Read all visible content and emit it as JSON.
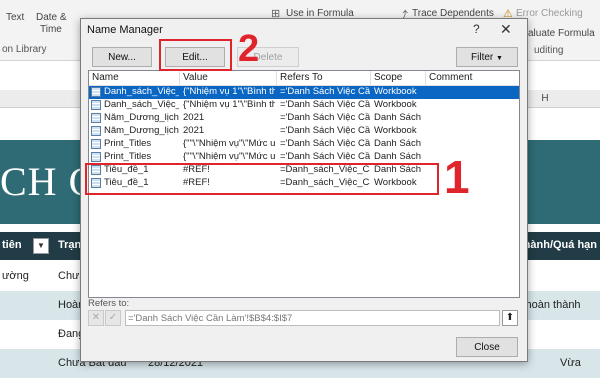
{
  "ribbon": {
    "text_label": "Text",
    "date_label": "Date &",
    "time_label": "Time",
    "library_label": "on Library",
    "use_in_formula": "Use in Formula",
    "trace_dependents": "Trace Dependents",
    "error_checking": "Error Checking",
    "evaluate_formula": "aluate Formula",
    "auditing_label": "uditing"
  },
  "sheet": {
    "col_h": "H",
    "big_text": "CH CẦ",
    "header": [
      "tiên",
      "Trạn",
      "thành/Quá hạn"
    ],
    "rows": [
      {
        "a": "ường",
        "b": "Chưa"
      },
      {
        "a": "",
        "b": "Hoàn",
        "c": "i hoàn thành"
      },
      {
        "a": "",
        "b": "Đang"
      },
      {
        "a": "Chưa Bắt đầu",
        "b": "28/12/2021",
        "c": "Vừa"
      }
    ]
  },
  "dialog": {
    "title": "Name Manager",
    "help": "?",
    "close_x": "✕",
    "buttons": {
      "new": "New...",
      "edit": "Edit...",
      "delete": "Delete",
      "filter": "Filter"
    },
    "columns": [
      "Name",
      "Value",
      "Refers To",
      "Scope",
      "Comment"
    ],
    "rows": [
      {
        "name": "Danh_sách_Việc_C...",
        "value": "{\"Nhiệm vụ 1\"\\\"Bình th...",
        "refers": "='Danh Sách Việc Cần ...",
        "scope": "Workbook",
        "selected": true
      },
      {
        "name": "Danh_sách_Việc_C...",
        "value": "{\"Nhiệm vụ 1\"\\\"Bình th...",
        "refers": "='Danh Sách Việc Cần ...",
        "scope": "Workbook",
        "selected": false
      },
      {
        "name": "Năm_Dương_lịch",
        "value": "2021",
        "refers": "='Danh Sách Việc Cần ...",
        "scope": "Danh Sách ...",
        "selected": false
      },
      {
        "name": "Năm_Dương_lịch",
        "value": "2021",
        "refers": "='Danh Sách Việc Cần ...",
        "scope": "Workbook",
        "selected": false
      },
      {
        "name": "Print_Titles",
        "value": "{\"\"\\\"Nhiệm vụ\"\\\"Mức ư...",
        "refers": "='Danh Sách Việc Cần ...",
        "scope": "Danh Sách ...",
        "selected": false
      },
      {
        "name": "Print_Titles",
        "value": "{\"\"\\\"Nhiệm vụ\"\\\"Mức ư...",
        "refers": "='Danh Sách Việc Cần ...",
        "scope": "Danh Sách ...",
        "selected": false
      },
      {
        "name": "Tiêu_đề_1",
        "value": "#REF!",
        "refers": "=Danh_sách_Việc_Cần...",
        "scope": "Danh Sách ...",
        "selected": false
      },
      {
        "name": "Tiêu_đề_1",
        "value": "#REF!",
        "refers": "=Danh_sách_Việc_Cần...",
        "scope": "Workbook",
        "selected": false
      }
    ],
    "refers_to_label": "Refers to:",
    "refers_to_value": "='Danh Sách Việc Cần Làm'!$B$4:$I$7",
    "close_button": "Close"
  },
  "annotations": {
    "step1": "1",
    "step2": "2"
  },
  "colors": {
    "accent_red": "#e0242c",
    "selection_blue": "#0a66c2",
    "teal": "#2e6b75"
  }
}
